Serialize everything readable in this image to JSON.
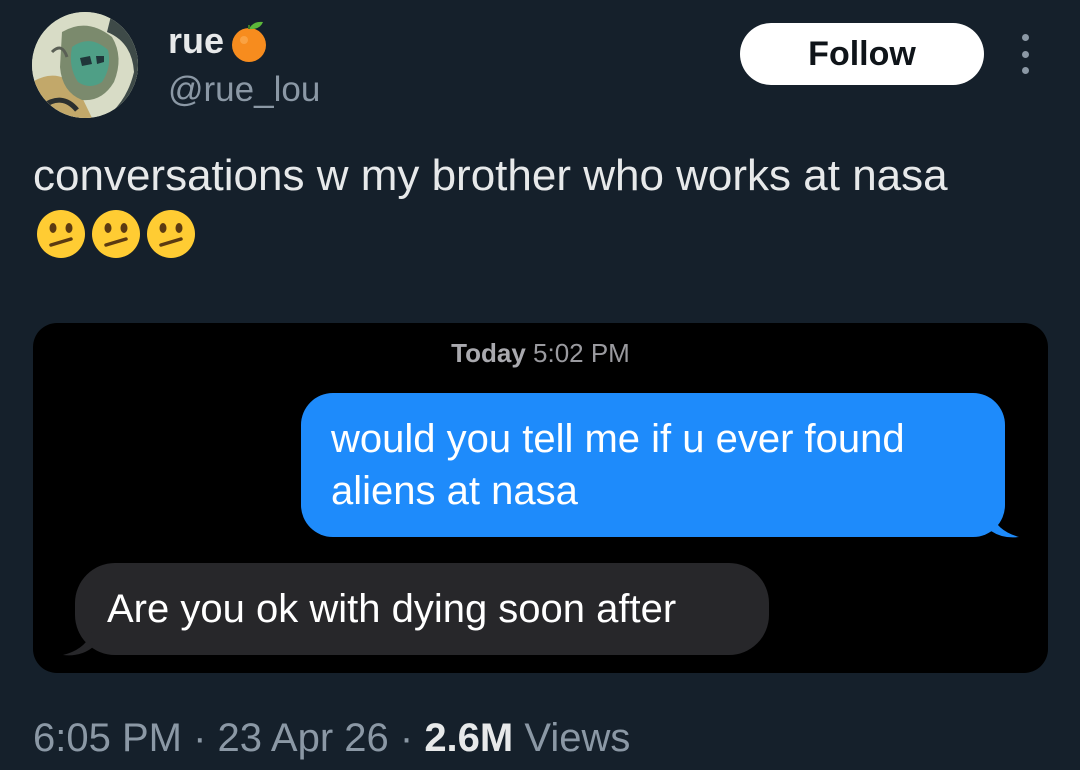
{
  "author": {
    "display_name": "rue",
    "handle": "@rue_lou",
    "name_emoji": "tangerine-icon"
  },
  "follow_label": "Follow",
  "tweet": {
    "text": "conversations w my brother who works at nasa",
    "emoji": [
      "confused-face-icon",
      "confused-face-icon",
      "confused-face-icon"
    ]
  },
  "screenshot": {
    "timestamp_day": "Today",
    "timestamp_time": "5:02 PM",
    "messages": [
      {
        "direction": "outgoing",
        "text": "would you tell me if u ever found aliens at nasa",
        "color": "#1e8bfb"
      },
      {
        "direction": "incoming",
        "text": "Are you ok with dying soon after",
        "color": "#27272a"
      }
    ]
  },
  "meta": {
    "time": "6:05 PM",
    "sep1": " · ",
    "date": "23 Apr 26",
    "sep2": " · ",
    "views_count": "2.6M",
    "views_label": " Views"
  },
  "colors": {
    "background": "#15202b",
    "secondary_text": "#8b98a5"
  }
}
